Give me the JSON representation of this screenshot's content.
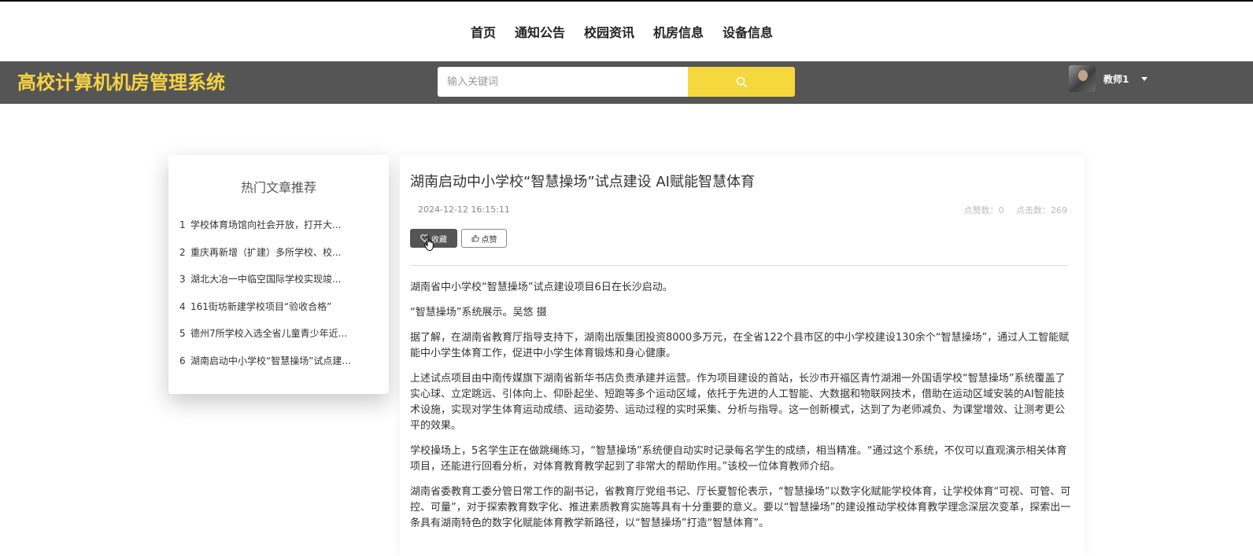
{
  "nav": {
    "items": [
      "首页",
      "通知公告",
      "校园资讯",
      "机房信息",
      "设备信息"
    ]
  },
  "header": {
    "logo": "高校计算机机房管理系统",
    "search_placeholder": "输入关键词",
    "username": "教师1"
  },
  "sidebar": {
    "title": "热门文章推荐",
    "items": [
      {
        "num": "1",
        "text": "学校体育场馆向社会开放，打开大..."
      },
      {
        "num": "2",
        "text": "重庆再新增（扩建）多所学校、校..."
      },
      {
        "num": "3",
        "text": "湖北大冶一中临空国际学校实现竣..."
      },
      {
        "num": "4",
        "text": "161街坊新建学校项目“验收合格”"
      },
      {
        "num": "5",
        "text": "德州7所学校入选全省儿童青少年近..."
      },
      {
        "num": "6",
        "text": "湖南启动中小学校“智慧操场”试点建..."
      }
    ]
  },
  "article": {
    "title": "湖南启动中小学校“智慧操场”试点建设 AI赋能智慧体育",
    "date": "2024-12-12 16:15:11",
    "likes_label": "点赞数：0",
    "clicks_label": "点击数：269",
    "fav_button": "收藏",
    "like_button": "点赞",
    "paragraphs": [
      "湖南省中小学校“智慧操场”试点建设项目6日在长沙启动。",
      "“智慧操场”系统展示。吴悠 摄",
      "据了解，在湖南省教育厅指导支持下，湖南出版集团投资8000多万元，在全省122个县市区的中小学校建设130余个“智慧操场”，通过人工智能赋能中小学生体育工作，促进中小学生体育锻炼和身心健康。",
      "上述试点项目由中南传媒旗下湖南省新华书店负责承建并运营。作为项目建设的首站，长沙市开福区青竹湖湘一外国语学校“智慧操场”系统覆盖了实心球、立定跳远、引体向上、仰卧起坐、短跑等多个运动区域，依托于先进的人工智能、大数据和物联网技术，借助在运动区域安装的AI智能技术设施，实现对学生体育运动成绩、运动姿势、运动过程的实时采集、分析与指导。这一创新模式，达到了为老师减负、为课堂增效、让测考更公平的效果。",
      "学校操场上，5名学生正在做跳绳练习，“智慧操场”系统便自动实时记录每名学生的成绩，相当精准。“通过这个系统，不仅可以直观演示相关体育项目，还能进行回看分析，对体育教育教学起到了非常大的帮助作用。”该校一位体育教师介绍。",
      "湖南省委教育工委分管日常工作的副书记，省教育厅党组书记、厅长夏智伦表示，“智慧操场”以数字化赋能学校体育，让学校体育“可视、可管、可控、可量”，对于探索教育数字化、推进素质教育实施等具有十分重要的意义。要以“智慧操场”的建设推动学校体育教学理念深层次变革，探索出一条具有湖南特色的数字化赋能体育教学新路径，以“智慧操场”打造“智慧体育”。"
    ]
  },
  "colors": {
    "header_bg": "#555555",
    "logo": "#f6d343",
    "search_button": "#f5d83e"
  }
}
